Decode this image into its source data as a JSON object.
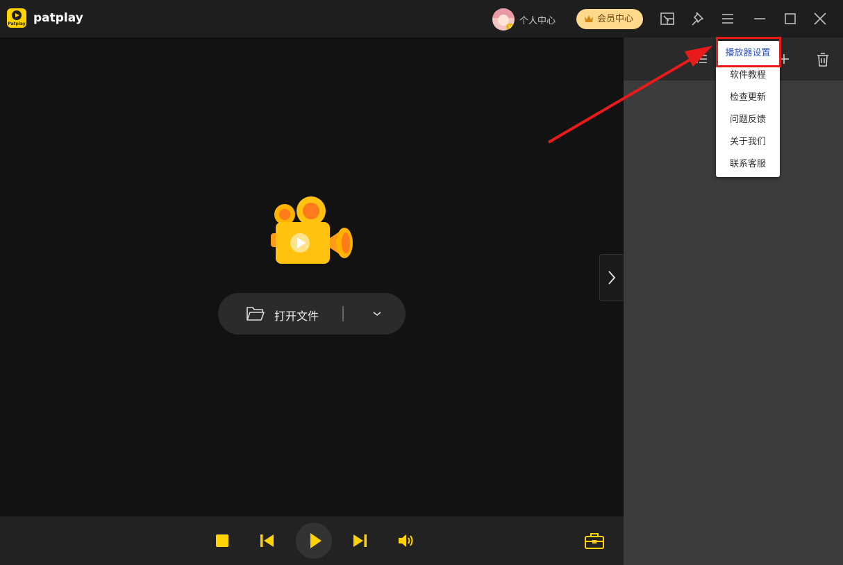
{
  "app": {
    "name": "patplay",
    "logo_text": "Patplay"
  },
  "header": {
    "personal_center": "个人中心",
    "vip_label": "会员中心",
    "avatar_badge": "V"
  },
  "main": {
    "open_file_label": "打开文件"
  },
  "menu": {
    "items": [
      {
        "label": "播放器设置",
        "active": true
      },
      {
        "label": "软件教程"
      },
      {
        "label": "检查更新"
      },
      {
        "label": "问题反馈"
      },
      {
        "label": "关于我们"
      },
      {
        "label": "联系客服"
      }
    ]
  },
  "icons": {
    "title_buttons": [
      "screen-cast-icon",
      "pin-icon",
      "menu-icon",
      "minimize-icon",
      "maximize-icon",
      "close-icon"
    ],
    "playback": [
      "stop-icon",
      "previous-icon",
      "play-icon",
      "next-icon",
      "volume-icon"
    ],
    "toolbox": "toolbox-icon"
  },
  "colors": {
    "accent": "#ffd200",
    "highlight": "#e81a1a",
    "menu_active": "#3057c8"
  }
}
